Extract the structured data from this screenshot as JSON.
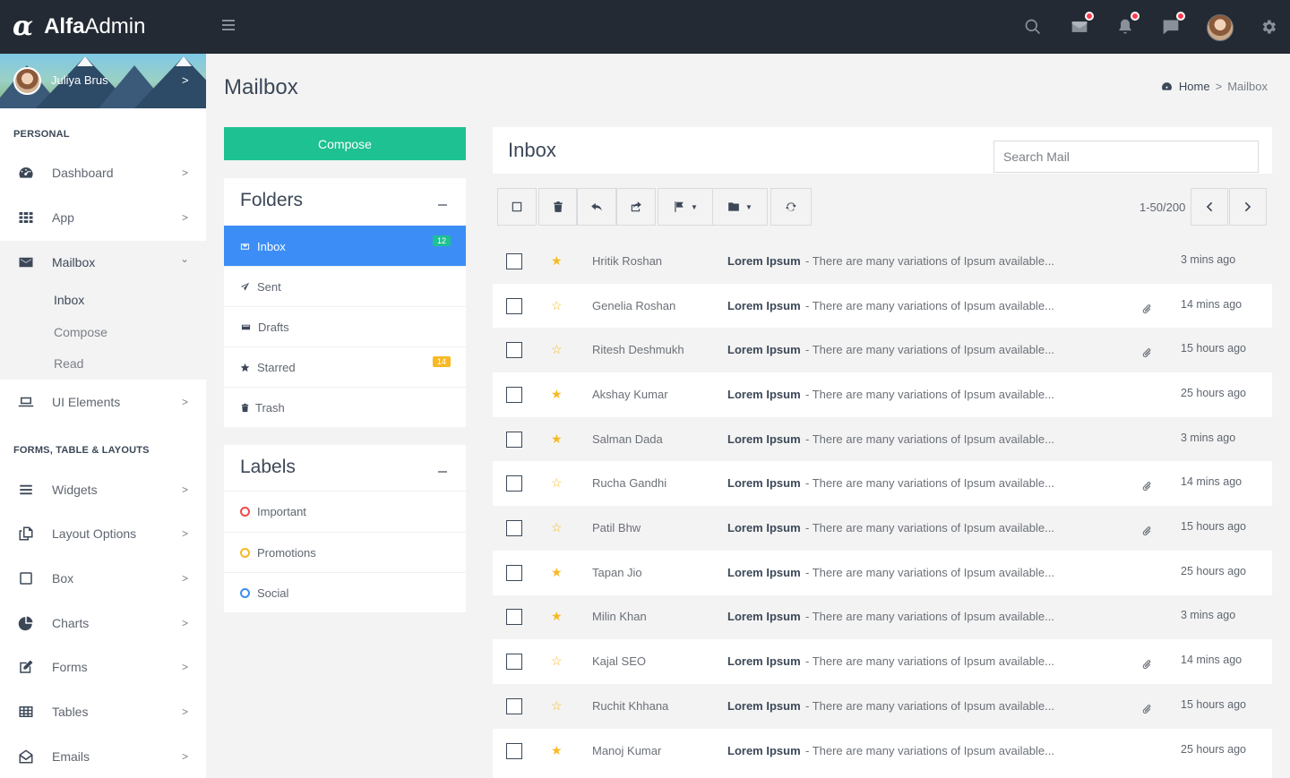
{
  "brand": {
    "logo": "α",
    "name_bold": "Alfa",
    "name_light": "Admin"
  },
  "topbar": {
    "icons": [
      "search-icon",
      "mail-icon",
      "bell-icon",
      "chat-icon",
      "avatar",
      "settings-icon"
    ]
  },
  "user": {
    "name": "Juliya Brus",
    "chevron": ">"
  },
  "sidebar": {
    "section_personal": "PERSONAL",
    "section_forms": "FORMS, TABLE & LAYOUTS",
    "chevron": ">",
    "chevron_down": "⌄",
    "items": [
      {
        "label": "Dashboard",
        "icon": "dashboard-icon"
      },
      {
        "label": "App",
        "icon": "grid-icon"
      },
      {
        "label": "Mailbox",
        "icon": "envelope-icon"
      },
      {
        "label": "UI Elements",
        "icon": "laptop-icon"
      },
      {
        "label": "Widgets",
        "icon": "bars-icon"
      },
      {
        "label": "Layout Options",
        "icon": "copy-icon"
      },
      {
        "label": "Box",
        "icon": "square-icon"
      },
      {
        "label": "Charts",
        "icon": "pie-chart-icon"
      },
      {
        "label": "Forms",
        "icon": "edit-icon"
      },
      {
        "label": "Tables",
        "icon": "table-icon"
      },
      {
        "label": "Emails",
        "icon": "envelope-open-icon"
      }
    ],
    "mailbox_sub": [
      "Inbox",
      "Compose",
      "Read"
    ]
  },
  "page": {
    "title": "Mailbox"
  },
  "breadcrumb": {
    "home": "Home",
    "separator": ">",
    "current": "Mailbox"
  },
  "compose": {
    "label": "Compose"
  },
  "folders": {
    "title": "Folders",
    "items": [
      {
        "label": "Inbox",
        "icon": "inbox-icon",
        "badge": "12",
        "badge_color": "#1ec191"
      },
      {
        "label": "Sent",
        "icon": "paper-plane-icon"
      },
      {
        "label": "Drafts",
        "icon": "drafts-icon"
      },
      {
        "label": "Starred",
        "icon": "star-icon",
        "badge": "14",
        "badge_color": "#f7b924"
      },
      {
        "label": "Trash",
        "icon": "trash-icon"
      }
    ]
  },
  "labels": {
    "title": "Labels",
    "items": [
      {
        "label": "Important",
        "color": "#ef4b4b"
      },
      {
        "label": "Promotions",
        "color": "#f7b924"
      },
      {
        "label": "Social",
        "color": "#3c8ef6"
      }
    ]
  },
  "inbox": {
    "title": "Inbox",
    "search_placeholder": "Search Mail",
    "pager": "1-50/200",
    "caret": "▼"
  },
  "mails": [
    {
      "from": "Hritik Roshan",
      "subject": "Lorem Ipsum",
      "snippet": "- There are many variations of Ipsum available...",
      "time": "3 mins ago",
      "starred": true,
      "attachment": false
    },
    {
      "from": "Genelia Roshan",
      "subject": "Lorem Ipsum",
      "snippet": "- There are many variations of Ipsum available...",
      "time": "14 mins ago",
      "starred": false,
      "attachment": true
    },
    {
      "from": "Ritesh Deshmukh",
      "subject": "Lorem Ipsum",
      "snippet": "- There are many variations of Ipsum available...",
      "time": "15 hours ago",
      "starred": false,
      "attachment": true
    },
    {
      "from": "Akshay Kumar",
      "subject": "Lorem Ipsum",
      "snippet": "- There are many variations of Ipsum available...",
      "time": "25 hours ago",
      "starred": true,
      "attachment": false
    },
    {
      "from": "Salman Dada",
      "subject": "Lorem Ipsum",
      "snippet": "- There are many variations of Ipsum available...",
      "time": "3 mins ago",
      "starred": true,
      "attachment": false
    },
    {
      "from": "Rucha Gandhi",
      "subject": "Lorem Ipsum",
      "snippet": "- There are many variations of Ipsum available...",
      "time": "14 mins ago",
      "starred": false,
      "attachment": true
    },
    {
      "from": "Patil Bhw",
      "subject": "Lorem Ipsum",
      "snippet": "- There are many variations of Ipsum available...",
      "time": "15 hours ago",
      "starred": false,
      "attachment": true
    },
    {
      "from": "Tapan Jio",
      "subject": "Lorem Ipsum",
      "snippet": "- There are many variations of Ipsum available...",
      "time": "25 hours ago",
      "starred": true,
      "attachment": false
    },
    {
      "from": "Milin Khan",
      "subject": "Lorem Ipsum",
      "snippet": "- There are many variations of Ipsum available...",
      "time": "3 mins ago",
      "starred": true,
      "attachment": false
    },
    {
      "from": "Kajal SEO",
      "subject": "Lorem Ipsum",
      "snippet": "- There are many variations of Ipsum available...",
      "time": "14 mins ago",
      "starred": false,
      "attachment": true
    },
    {
      "from": "Ruchit Khhana",
      "subject": "Lorem Ipsum",
      "snippet": "- There are many variations of Ipsum available...",
      "time": "15 hours ago",
      "starred": false,
      "attachment": true
    },
    {
      "from": "Manoj Kumar",
      "subject": "Lorem Ipsum",
      "snippet": "- There are many variations of Ipsum available...",
      "time": "25 hours ago",
      "starred": true,
      "attachment": false
    }
  ],
  "colors": {
    "topbar": "#242a33",
    "accent_green": "#1ec191",
    "accent_blue": "#3c8ef6",
    "star": "#f7b924",
    "notification": "#ff3b4e"
  }
}
